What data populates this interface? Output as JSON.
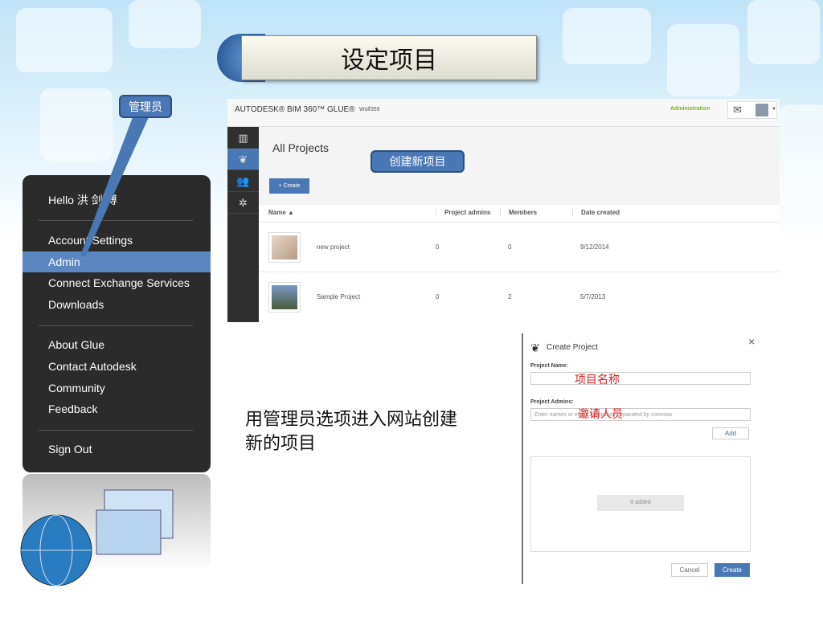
{
  "slide_title": "设定项目",
  "callouts": {
    "admin": "管理员",
    "create_new": "创建新项目"
  },
  "menu": {
    "greeting": "Hello 洪 剑 博",
    "items": [
      "Account Settings",
      "Admin",
      "Connect Exchange Services",
      "Downloads",
      "About Glue",
      "Contact Autodesk",
      "Community",
      "Feedback",
      "Sign Out"
    ]
  },
  "app": {
    "brand": "AUTODESK® BIM 360™ GLUE®",
    "account": "Wolf359",
    "admin_link": "Administration",
    "page_title": "All Projects",
    "create_button": "+ Create",
    "columns": [
      "Name ▲",
      "Project admins",
      "Members",
      "Date created"
    ],
    "rows": [
      {
        "name": "new project",
        "admins": "0",
        "members": "0",
        "date": "9/12/2014"
      },
      {
        "name": "Sample Project",
        "admins": "0",
        "members": "2",
        "date": "5/7/2013"
      }
    ]
  },
  "dialog": {
    "title": "Create Project",
    "name_label": "Project Name:",
    "name_annotation": "项目名称",
    "admins_label": "Project Admins:",
    "admins_placeholder": "Enter names or email addresses separated by commas",
    "admins_annotation": "邀请人员",
    "add": "Add",
    "added": "0 added",
    "cancel": "Cancel",
    "create": "Create",
    "close": "×"
  },
  "caption": [
    "用管理员选项进入网站创建",
    "新的项目"
  ]
}
